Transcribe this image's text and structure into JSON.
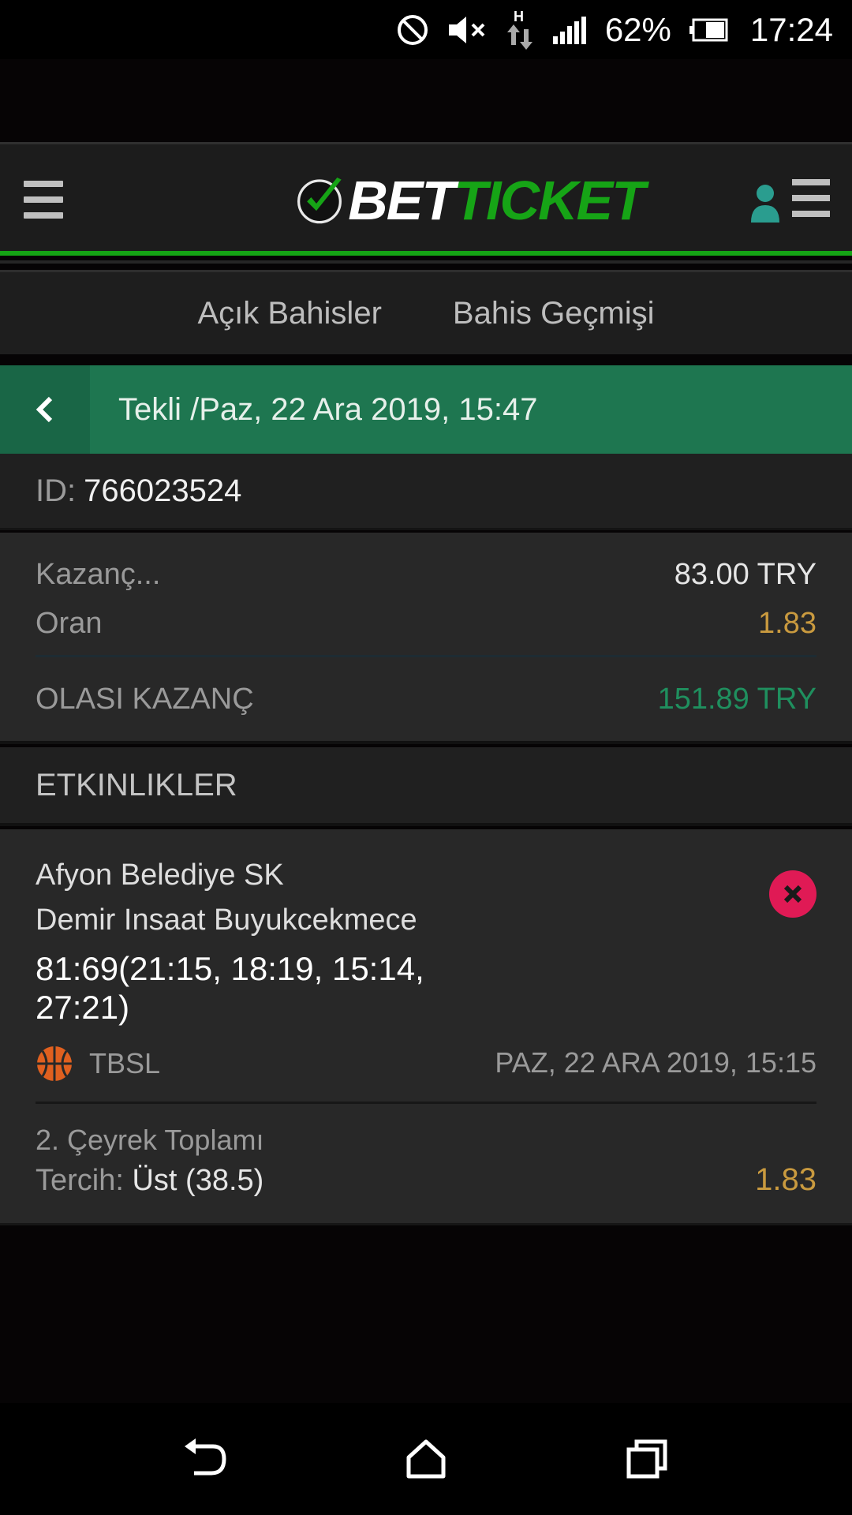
{
  "status_bar": {
    "battery_percent": "62%",
    "time": "17:24",
    "network_label": "H",
    "icons": [
      "do-not-disturb-icon",
      "mute-icon",
      "data-transfer-icon",
      "signal-icon",
      "battery-icon"
    ]
  },
  "header": {
    "logo_part1": "BET",
    "logo_part2": "TICKET",
    "menu_icon": "hamburger-icon",
    "user_icon": "user-icon"
  },
  "tabs": [
    {
      "label": "Açık Bahisler"
    },
    {
      "label": "Bahis Geçmişi"
    }
  ],
  "ticket": {
    "title": "Tekli /Paz, 22 Ara 2019, 15:47",
    "id_label": "ID:",
    "id_value": "766023524"
  },
  "summary": {
    "stake_label": "Kazanç...",
    "stake_value": "83.00 TRY",
    "odds_label": "Oran",
    "odds_value": "1.83",
    "potential_label": "OLASI KAZANÇ",
    "potential_value": "151.89 TRY"
  },
  "events_header": "ETKINLIKLER",
  "event": {
    "home_team": "Afyon Belediye SK",
    "away_team": "Demir Insaat Buyukcekmece",
    "score_line1": "81:69(21:15, 18:19, 15:14,",
    "score_line2": "27:21)",
    "league": "TBSL",
    "date": "PAZ, 22 ARA 2019, 15:15",
    "market": "2. Çeyrek Toplamı",
    "pick_label": "Tercih:",
    "pick_value": "Üst (38.5)",
    "odd": "1.83"
  },
  "colors": {
    "brand_green": "#16a416",
    "title_bar": "#1e7650",
    "odds_gold": "#c99a3f",
    "win_green": "#1f8f5e",
    "remove_red": "#e01a55"
  }
}
